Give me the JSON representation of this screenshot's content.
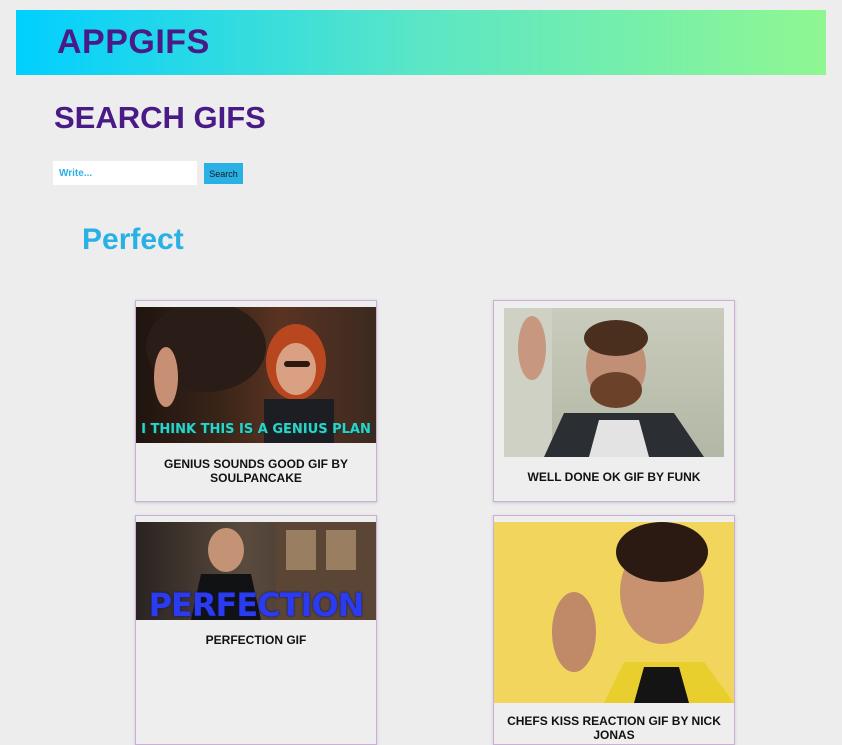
{
  "header": {
    "title": "APPGIFS"
  },
  "search": {
    "heading": "SEARCH GIFS",
    "placeholder": "Write...",
    "button_label": "Search"
  },
  "results": {
    "heading": "Perfect",
    "items": [
      {
        "title": "GENIUS SOUNDS GOOD GIF BY SOULPANCAKE",
        "overlay_text": "I THINK THIS IS A GENIUS PLAN"
      },
      {
        "title": "WELL DONE OK GIF BY FUNK",
        "overlay_text": ""
      },
      {
        "title": "PERFECTION GIF",
        "overlay_text": "PERFECTION"
      },
      {
        "title": "CHEFS KISS REACTION GIF BY NICK JONAS",
        "overlay_text": ""
      }
    ]
  },
  "colors": {
    "header_gradient": [
      "#00cfff",
      "#8ff791"
    ],
    "brand_purple": "#4a1a86",
    "accent_blue": "#29b1e6",
    "background": "#ededed"
  }
}
